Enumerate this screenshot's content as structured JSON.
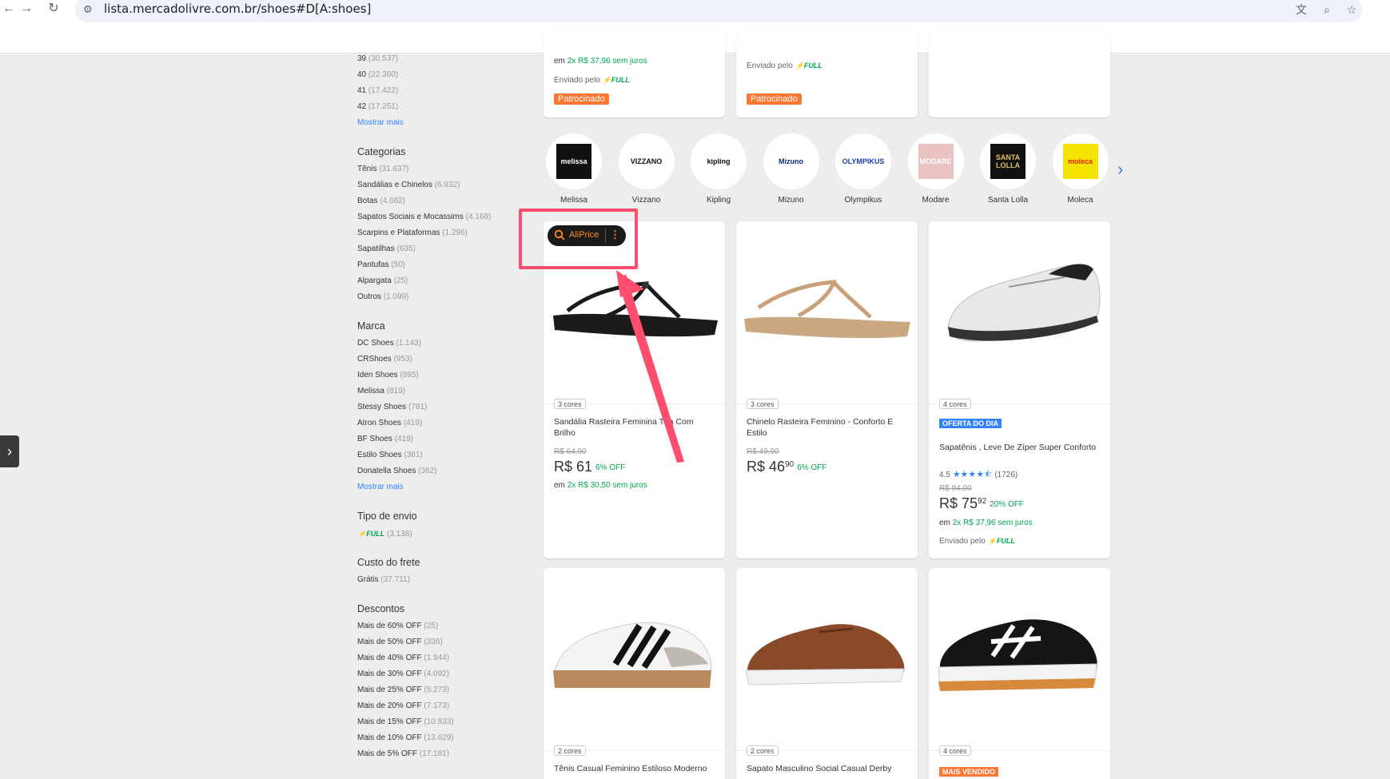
{
  "browser": {
    "url": "lista.mercadolivre.com.br/shoes#D[A:shoes]",
    "icons": [
      "back-arrow-icon",
      "forward-arrow-icon",
      "reload-icon",
      "site-info-icon",
      "translate-icon",
      "zoom-icon",
      "bookmark-star-icon"
    ]
  },
  "sidebar": {
    "sizes": [
      {
        "label": "39",
        "count": "(30.537)"
      },
      {
        "label": "40",
        "count": "(22.360)"
      },
      {
        "label": "41",
        "count": "(17.422)"
      },
      {
        "label": "42",
        "count": "(17.251)"
      }
    ],
    "sizes_more": "Mostrar mais",
    "categorias_title": "Categorias",
    "categorias": [
      {
        "label": "Tênis",
        "count": "(31.637)"
      },
      {
        "label": "Sandálias e Chinelos",
        "count": "(6.932)"
      },
      {
        "label": "Botas",
        "count": "(4.682)"
      },
      {
        "label": "Sapatos Sociais e Mocassims",
        "count": "(4.168)"
      },
      {
        "label": "Scarpins e Plataformas",
        "count": "(1.296)"
      },
      {
        "label": "Sapatilhas",
        "count": "(635)"
      },
      {
        "label": "Pantufas",
        "count": "(50)"
      },
      {
        "label": "Alpargata",
        "count": "(25)"
      },
      {
        "label": "Outros",
        "count": "(1.099)"
      }
    ],
    "marca_title": "Marca",
    "marcas": [
      {
        "label": "DC Shoes",
        "count": "(1.143)"
      },
      {
        "label": "CRShoes",
        "count": "(953)"
      },
      {
        "label": "Iden Shoes",
        "count": "(895)"
      },
      {
        "label": "Melissa",
        "count": "(819)"
      },
      {
        "label": "Stessy Shoes",
        "count": "(781)"
      },
      {
        "label": "Atron Shoes",
        "count": "(419)"
      },
      {
        "label": "BF Shoes",
        "count": "(419)"
      },
      {
        "label": "Estilo Shoes",
        "count": "(381)"
      },
      {
        "label": "Donatella Shoes",
        "count": "(362)"
      }
    ],
    "marca_more": "Mostrar mais",
    "envio_title": "Tipo de envio",
    "envio_full": "FULL",
    "envio_count": "(3.138)",
    "frete_title": "Custo do frete",
    "frete_label": "Grátis",
    "frete_count": "(37.711)",
    "descontos_title": "Descontos",
    "descontos": [
      {
        "label": "Mais de 60% OFF",
        "count": "(25)"
      },
      {
        "label": "Mais de 50% OFF",
        "count": "(336)"
      },
      {
        "label": "Mais de 40% OFF",
        "count": "(1.944)"
      },
      {
        "label": "Mais de 30% OFF",
        "count": "(4.092)"
      },
      {
        "label": "Mais de 25% OFF",
        "count": "(5.273)"
      },
      {
        "label": "Mais de 20% OFF",
        "count": "(7.173)"
      },
      {
        "label": "Mais de 15% OFF",
        "count": "(10.833)"
      },
      {
        "label": "Mais de 10% OFF",
        "count": "(13.629)"
      },
      {
        "label": "Mais de 5% OFF",
        "count": "(17.181)"
      }
    ]
  },
  "top_cards": {
    "c1_installments_prefix": "em",
    "c1_installments": "2x R$ 37,96 sem juros",
    "sent_by": "Enviado pelo",
    "full": "FULL",
    "sponsored": "Patrocinado"
  },
  "brands": [
    "Melissa",
    "Vizzano",
    "Kipling",
    "Mizuno",
    "Olympikus",
    "Modare",
    "Santa Lolla",
    "Moleca"
  ],
  "brand_logos": {
    "melissa": "melissa",
    "vizzano": "VIZZANO",
    "kipling": "kipling",
    "mizuno": "Mizuno",
    "olympikus": "OLYMPIKUS",
    "modare": "MODARE",
    "santa_lolla": "SANTA LOLLA",
    "moleca": "moleca"
  },
  "aliprice": {
    "label": "AliPrice",
    "menu": "⋮"
  },
  "products": [
    {
      "colors": "3 cores",
      "title": "Sandália Rasteira Feminina Tira Com Brilho",
      "old_price": "R$ 64,90",
      "price": "R$ 61",
      "cents": "",
      "off": "6% OFF",
      "inst_prefix": "em",
      "installments": "2x R$ 30,50 sem juros"
    },
    {
      "colors": "3 cores",
      "title": "Chinelo Rasteira Feminino - Conforto E Estilo",
      "old_price": "R$ 49,90",
      "price": "R$ 46",
      "cents": "90",
      "off": "6% OFF"
    },
    {
      "colors": "4 cores",
      "badge": "OFERTA DO DIA",
      "title": "Sapatênis , Leve De Zíper Super Conforto",
      "rating": "4.5",
      "reviews": "(1726)",
      "stars": "★★★★⯪",
      "old_price": "R$ 94,90",
      "price": "R$ 75",
      "cents": "92",
      "off": "20% OFF",
      "inst_prefix": "em",
      "installments": "2x R$ 37,96 sem juros",
      "sent_by": "Enviado pelo",
      "full": "FULL"
    },
    {
      "colors": "2 cores",
      "title": "Tênis Casual Feminino Estiloso Moderno"
    },
    {
      "colors": "2 cores",
      "title": "Sapato Masculino Social Casual Derby"
    },
    {
      "colors": "4 cores",
      "badge": "MAIS VENDIDO"
    }
  ],
  "colors": {
    "accent_blue": "#3483fa",
    "green": "#00a650",
    "orange": "#ff7733",
    "highlight": "#ff4d6d"
  }
}
